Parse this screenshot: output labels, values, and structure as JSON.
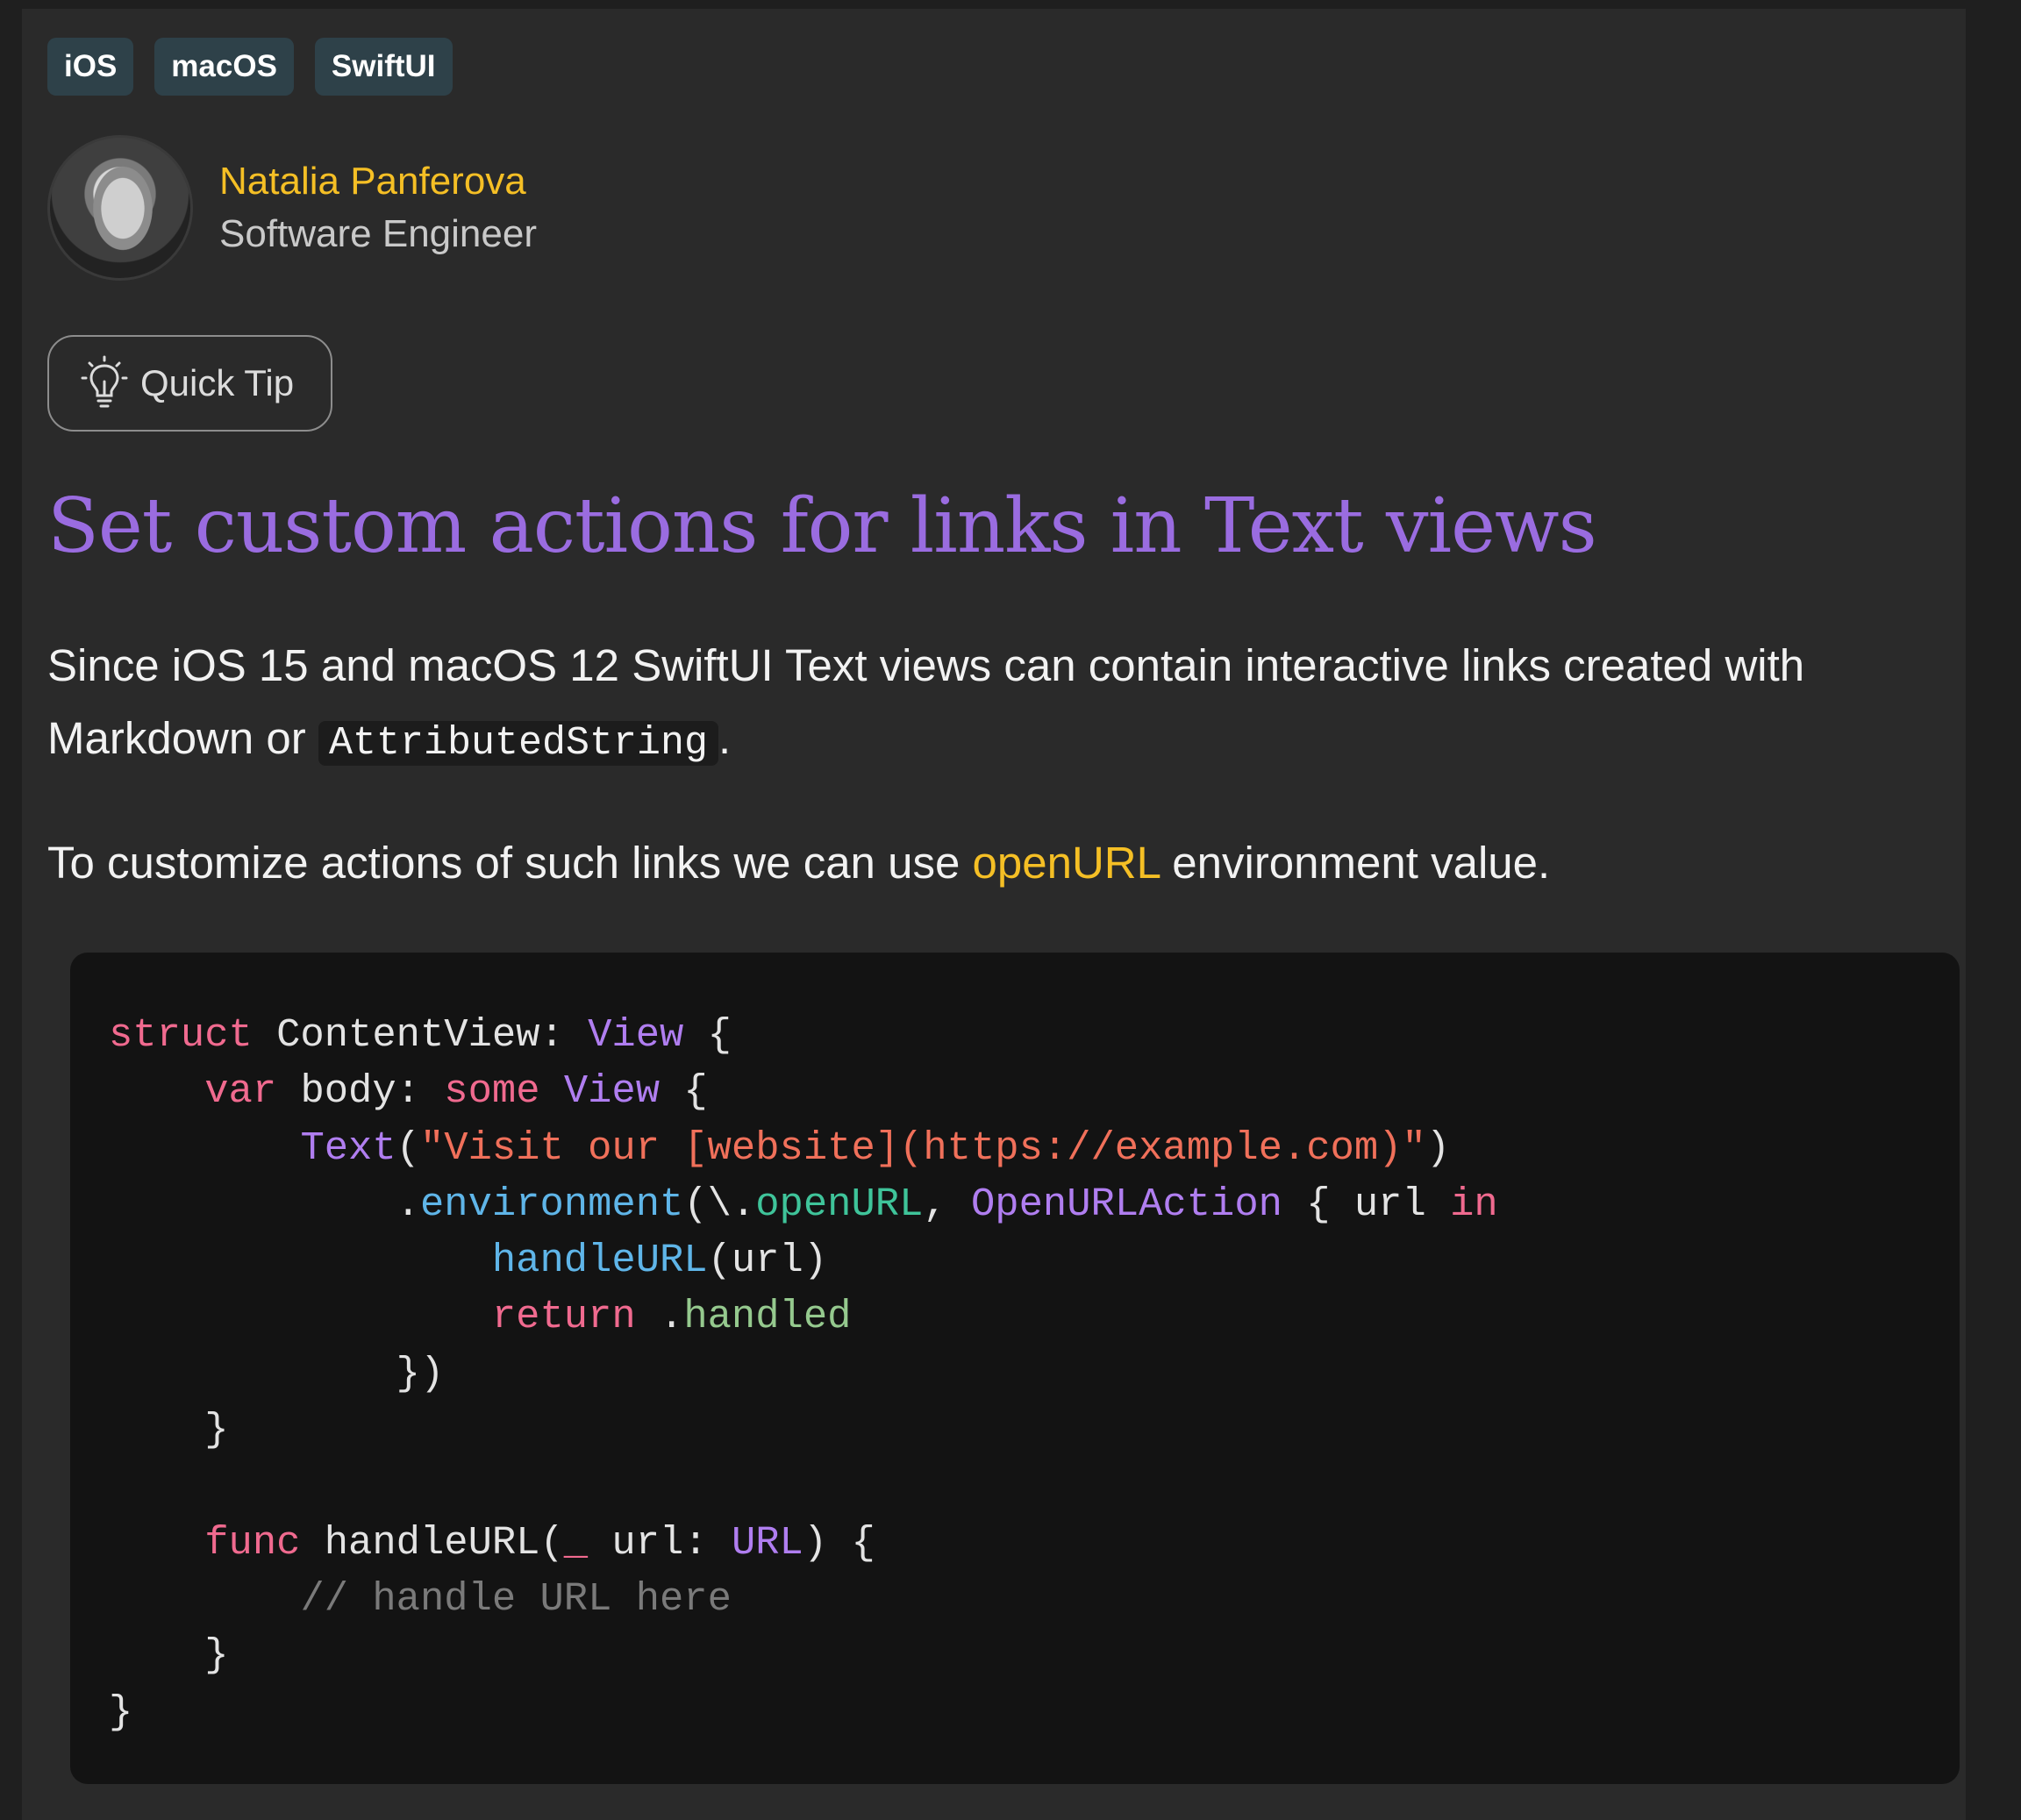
{
  "tags": [
    "iOS",
    "macOS",
    "SwiftUI"
  ],
  "author": {
    "name": "Natalia Panferova",
    "role": "Software Engineer"
  },
  "badge": {
    "label": "Quick Tip",
    "icon": "lightbulb-icon"
  },
  "title": "Set custom actions for links in Text views",
  "paragraph1": {
    "text_before": "Since iOS 15 and macOS 12 SwiftUI Text views can contain interactive links created with Markdown or ",
    "code": "AttributedString",
    "text_after": "."
  },
  "paragraph2": {
    "text_before": "To customize actions of such links we can use ",
    "link": "openURL",
    "text_after": " environment value."
  },
  "code_lines": [
    [
      {
        "t": "struct",
        "c": "kw"
      },
      {
        "t": " ContentView: "
      },
      {
        "t": "View",
        "c": "ty"
      },
      {
        "t": " {"
      }
    ],
    [
      {
        "t": "    "
      },
      {
        "t": "var",
        "c": "kw"
      },
      {
        "t": " body: "
      },
      {
        "t": "some",
        "c": "kw"
      },
      {
        "t": " "
      },
      {
        "t": "View",
        "c": "ty"
      },
      {
        "t": " {"
      }
    ],
    [
      {
        "t": "        "
      },
      {
        "t": "Text",
        "c": "ty"
      },
      {
        "t": "("
      },
      {
        "t": "\"Visit our [website](https://example.com)\"",
        "c": "str"
      },
      {
        "t": ")"
      }
    ],
    [
      {
        "t": "            ."
      },
      {
        "t": "environment",
        "c": "fn"
      },
      {
        "t": "(\\."
      },
      {
        "t": "openURL",
        "c": "grn"
      },
      {
        "t": ", "
      },
      {
        "t": "OpenURLAction",
        "c": "ty"
      },
      {
        "t": " { url "
      },
      {
        "t": "in",
        "c": "kw"
      }
    ],
    [
      {
        "t": "                "
      },
      {
        "t": "handleURL",
        "c": "fn"
      },
      {
        "t": "(url)"
      }
    ],
    [
      {
        "t": "                "
      },
      {
        "t": "return",
        "c": "kw"
      },
      {
        "t": " ."
      },
      {
        "t": "handled",
        "c": "en"
      }
    ],
    [
      {
        "t": "            })"
      }
    ],
    [
      {
        "t": "    }"
      }
    ],
    [
      {
        "t": ""
      }
    ],
    [
      {
        "t": "    "
      },
      {
        "t": "func",
        "c": "kw"
      },
      {
        "t": " handleURL("
      },
      {
        "t": "_",
        "c": "kw"
      },
      {
        "t": " url: "
      },
      {
        "t": "URL",
        "c": "ty"
      },
      {
        "t": ") {"
      }
    ],
    [
      {
        "t": "        "
      },
      {
        "t": "// handle URL here",
        "c": "cm"
      }
    ],
    [
      {
        "t": "    }"
      }
    ],
    [
      {
        "t": "}"
      }
    ]
  ],
  "colors": {
    "accent_yellow": "#f5bf25",
    "title_purple": "#9a6ce0",
    "tag_background": "#2e4149"
  }
}
